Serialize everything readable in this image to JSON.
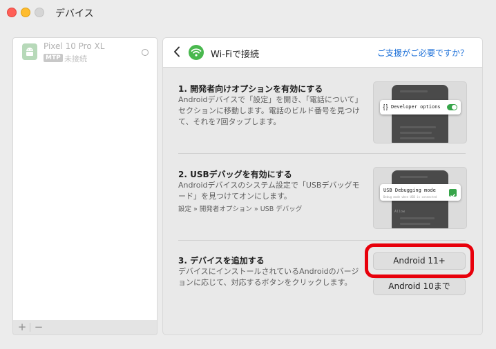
{
  "window": {
    "title": "デバイス"
  },
  "sidebar": {
    "devices": [
      {
        "name": "Pixel 10 Pro XL",
        "badge": "MTP",
        "status": "未接続"
      }
    ],
    "footer": {
      "add_label": "+",
      "remove_label": "−"
    }
  },
  "panel": {
    "title": "Wi-Fiで接続",
    "help_link": "ご支援がご必要ですか？",
    "steps": [
      {
        "title": "1. 開発者向けオプションを有効にする",
        "description": "Androidデバイスで「設定」を開き、「電話について」セクションに移動します。電話のビルド番号を見つけて、それを7回タップします。",
        "illustration": {
          "card_label": "Developer options"
        }
      },
      {
        "title": "2. USBデバッグを有効にする",
        "description": "Androidデバイスのシステム設定で「USBデバッグモード」を見つけてオンにします。",
        "path": "設定 » 開発者オプション » USB デバッグ",
        "illustration": {
          "card_label": "USB Debugging mode",
          "card_sub": "Debug mode when USB is connected",
          "allow_label": "Allow"
        }
      },
      {
        "title": "3. デバイスを追加する",
        "description": "デバイスにインストールされているAndroidのバージョンに応じて、対応するボタンをクリックします。",
        "buttons": [
          "Android 11+",
          "Android 10まで"
        ]
      }
    ]
  },
  "colors": {
    "accent": "#1b6fd8",
    "highlight": "#e8000b",
    "wifi": "#49b84e",
    "toggle_on": "#37a54a"
  }
}
